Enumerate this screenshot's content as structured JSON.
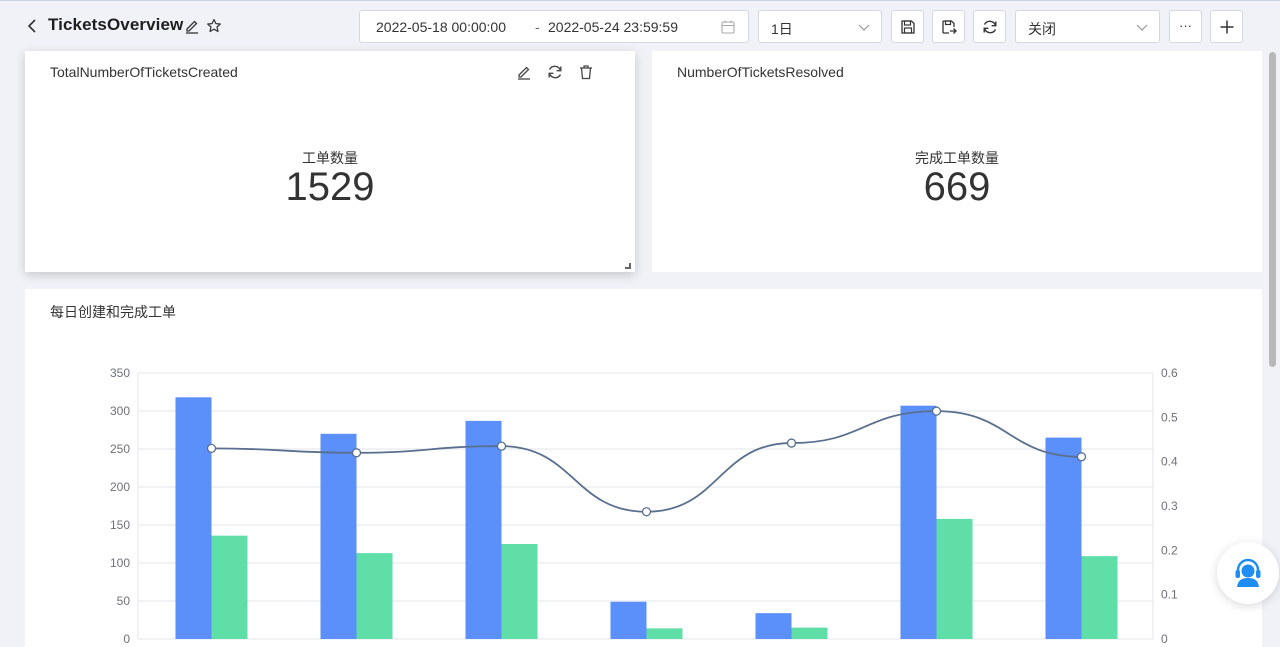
{
  "header": {
    "title": "TicketsOverview",
    "date_start": "2022-05-18 00:00:00",
    "date_separator": "-",
    "date_end": "2022-05-24 23:59:59",
    "granularity": "1日",
    "refresh_mode": "关闭",
    "more_label": "···"
  },
  "cards": {
    "created": {
      "title": "TotalNumberOfTicketsCreated",
      "label": "工单数量",
      "value": "1529"
    },
    "resolved": {
      "title": "NumberOfTicketsResolved",
      "label": "完成工单数量",
      "value": "669"
    }
  },
  "chart_card": {
    "title": "每日创建和完成工单"
  },
  "chart_data": {
    "type": "bar",
    "title": "每日创建和完成工单",
    "series": [
      {
        "type": "bar",
        "axis": "left",
        "color": "#5b8ff9",
        "values": [
          318,
          270,
          287,
          49,
          34,
          307,
          265
        ]
      },
      {
        "type": "bar",
        "axis": "left",
        "color": "#5fdea8",
        "values": [
          136,
          113,
          125,
          14,
          15,
          158,
          109
        ]
      },
      {
        "type": "line",
        "axis": "right",
        "color": "#5a6f8e",
        "smooth": true,
        "values": [
          0.43,
          0.42,
          0.435,
          0.287,
          0.442,
          0.514,
          0.411
        ]
      }
    ],
    "y_left": {
      "min": 0,
      "max": 350,
      "ticks": [
        "0",
        "50",
        "100",
        "150",
        "200",
        "250",
        "300",
        "350"
      ]
    },
    "y_right": {
      "min": 0,
      "max": 0.6,
      "ticks": [
        "0",
        "0.1",
        "0.2",
        "0.3",
        "0.4",
        "0.5",
        "0.6"
      ]
    },
    "grid": true
  },
  "colors": {
    "accent": "#5b8ff9",
    "secondary": "#5fdea8",
    "line": "#5a6f8e",
    "support": "#1e8cf0"
  }
}
